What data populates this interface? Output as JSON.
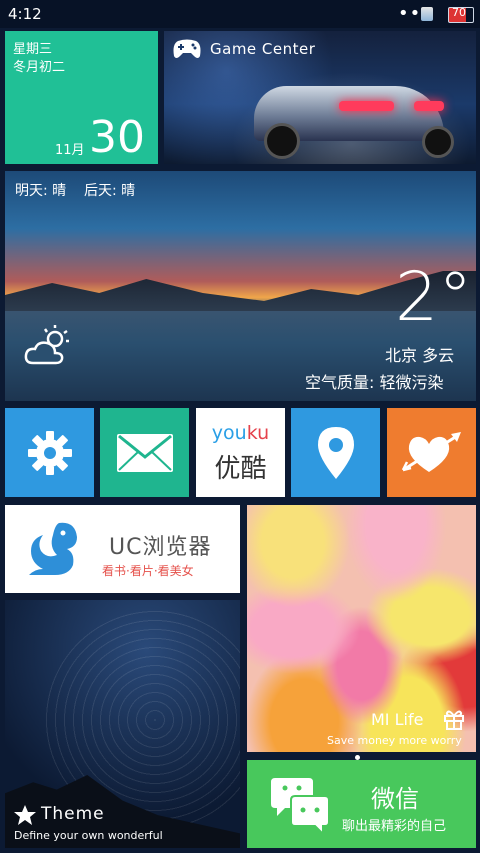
{
  "status": {
    "time": "4:12",
    "dots": "•••",
    "battery": "70"
  },
  "date_tile": {
    "weekday": "星期三",
    "lunar": "冬月初二",
    "month": "11月",
    "day": "30"
  },
  "game_center": {
    "label": "Game Center"
  },
  "weather": {
    "forecast": "明天: 晴    后天: 晴",
    "temperature": "2°",
    "city": "北京 多云",
    "air_quality": "空气质量: 轻微污染"
  },
  "youku": {
    "word_you": "you",
    "word_ku": "ku",
    "name_cn": "优酷"
  },
  "uc": {
    "title": "UC浏览器",
    "subtitle": "看书·看片·看美女"
  },
  "milife": {
    "title": "MI Life",
    "subtitle": "Save money more worry"
  },
  "theme": {
    "title": "Theme",
    "subtitle": "Define your own wonderful"
  },
  "wechat": {
    "title": "微信",
    "subtitle": "聊出最精彩的自己"
  },
  "colors": {
    "date_tile": "#20c096",
    "blue": "#2f99e0",
    "mail": "#1fb58f",
    "love": "#ef7c2f",
    "wechat": "#48c85c",
    "uc_red": "#e5524c",
    "youku_blue": "#2a9fe6",
    "youku_red": "#e5424c"
  },
  "icons": [
    "gamepad-icon",
    "cloud-sun-icon",
    "gear-icon",
    "mail-icon",
    "map-pin-icon",
    "heart-arrow-icon",
    "squirrel-icon",
    "gift-icon",
    "star-icon",
    "chat-bubbles-icon"
  ]
}
